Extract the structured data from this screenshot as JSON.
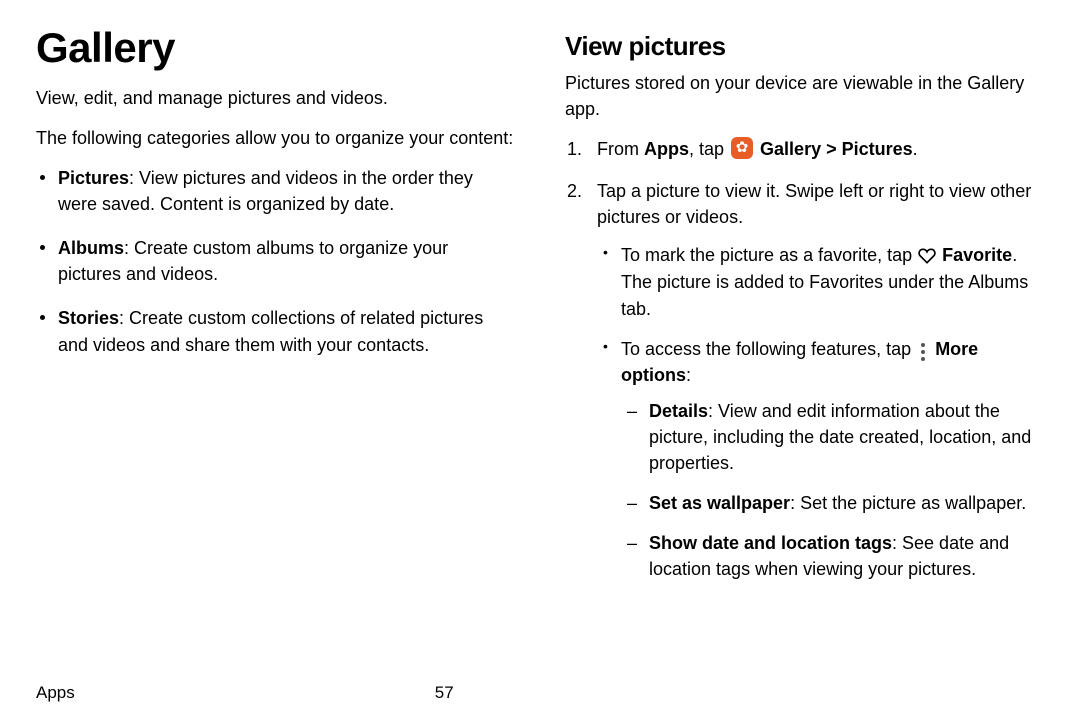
{
  "left": {
    "title": "Gallery",
    "intro": "View, edit, and manage pictures and videos.",
    "lead": "The following categories allow you to organize your content:",
    "categories": [
      {
        "name": "Pictures",
        "desc": ": View pictures and videos in the order they were saved. Content is organized by date."
      },
      {
        "name": "Albums",
        "desc": ": Create custom albums to organize your pictures and videos."
      },
      {
        "name": "Stories",
        "desc": ": Create custom collections of related pictures and videos and share them with your contacts."
      }
    ]
  },
  "right": {
    "title": "View pictures",
    "intro": "Pictures stored on your device are viewable in the Gallery app.",
    "step1": {
      "pre": "From ",
      "apps": "Apps",
      "mid": ", tap ",
      "gallery": "Gallery",
      "sep": " > ",
      "pictures": "Pictures",
      "post": "."
    },
    "step2": "Tap a picture to view it. Swipe left or right to view other pictures or videos.",
    "fav": {
      "pre": "To mark the picture as a favorite, tap ",
      "label": "Favorite",
      "post": ". The picture is added to Favorites under the Albums tab."
    },
    "more": {
      "pre": "To access the following features, tap ",
      "label": "More options",
      "post": ":"
    },
    "opts": [
      {
        "name": "Details",
        "desc": ": View and edit information about the picture, including the date created, location, and properties."
      },
      {
        "name": "Set as wallpaper",
        "desc": ": Set the picture as wallpaper."
      },
      {
        "name": "Show date and location tags",
        "desc": ": See date and location tags when viewing your pictures."
      }
    ]
  },
  "footer": {
    "section": "Apps",
    "page": "57"
  }
}
